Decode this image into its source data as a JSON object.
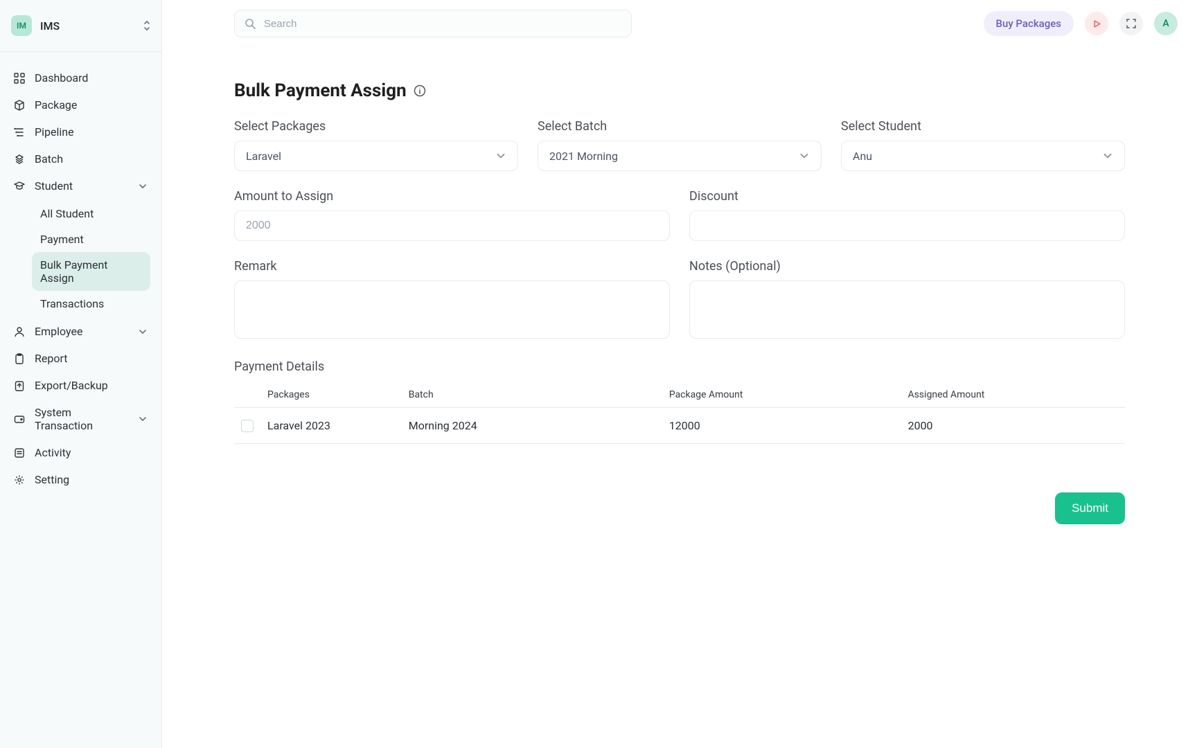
{
  "org": {
    "initials": "IM",
    "name": "IMS"
  },
  "sidebar": {
    "items": [
      {
        "label": "Dashboard"
      },
      {
        "label": "Package"
      },
      {
        "label": "Pipeline"
      },
      {
        "label": "Batch"
      },
      {
        "label": "Student"
      },
      {
        "label": "Employee"
      },
      {
        "label": "Report"
      },
      {
        "label": "Export/Backup"
      },
      {
        "label": "System Transaction"
      },
      {
        "label": "Activity"
      },
      {
        "label": "Setting"
      }
    ],
    "student_sub": [
      {
        "label": "All Student"
      },
      {
        "label": "Payment"
      },
      {
        "label": "Bulk Payment Assign"
      },
      {
        "label": "Transactions"
      }
    ]
  },
  "search": {
    "placeholder": "Search"
  },
  "header": {
    "buy_label": "Buy Packages",
    "avatar_initial": "A"
  },
  "page": {
    "title": "Bulk Payment Assign",
    "labels": {
      "select_packages": "Select Packages",
      "select_batch": "Select Batch",
      "select_student": "Select Student",
      "amount_to_assign": "Amount to Assign",
      "discount": "Discount",
      "remark": "Remark",
      "notes": "Notes (Optional)",
      "payment_details": "Payment Details"
    },
    "values": {
      "package": "Laravel",
      "batch": "2021 Morning",
      "student": "Anu",
      "amount_placeholder": "2000",
      "discount": "",
      "remark": "",
      "notes": ""
    },
    "table": {
      "columns": {
        "packages": "Packages",
        "batch": "Batch",
        "package_amount": "Package Amount",
        "assigned_amount": "Assigned Amount"
      },
      "rows": [
        {
          "packages": "Laravel 2023",
          "batch": "Morning 2024",
          "package_amount": "12000",
          "assigned_amount": "2000"
        }
      ]
    },
    "submit_label": "Submit"
  }
}
